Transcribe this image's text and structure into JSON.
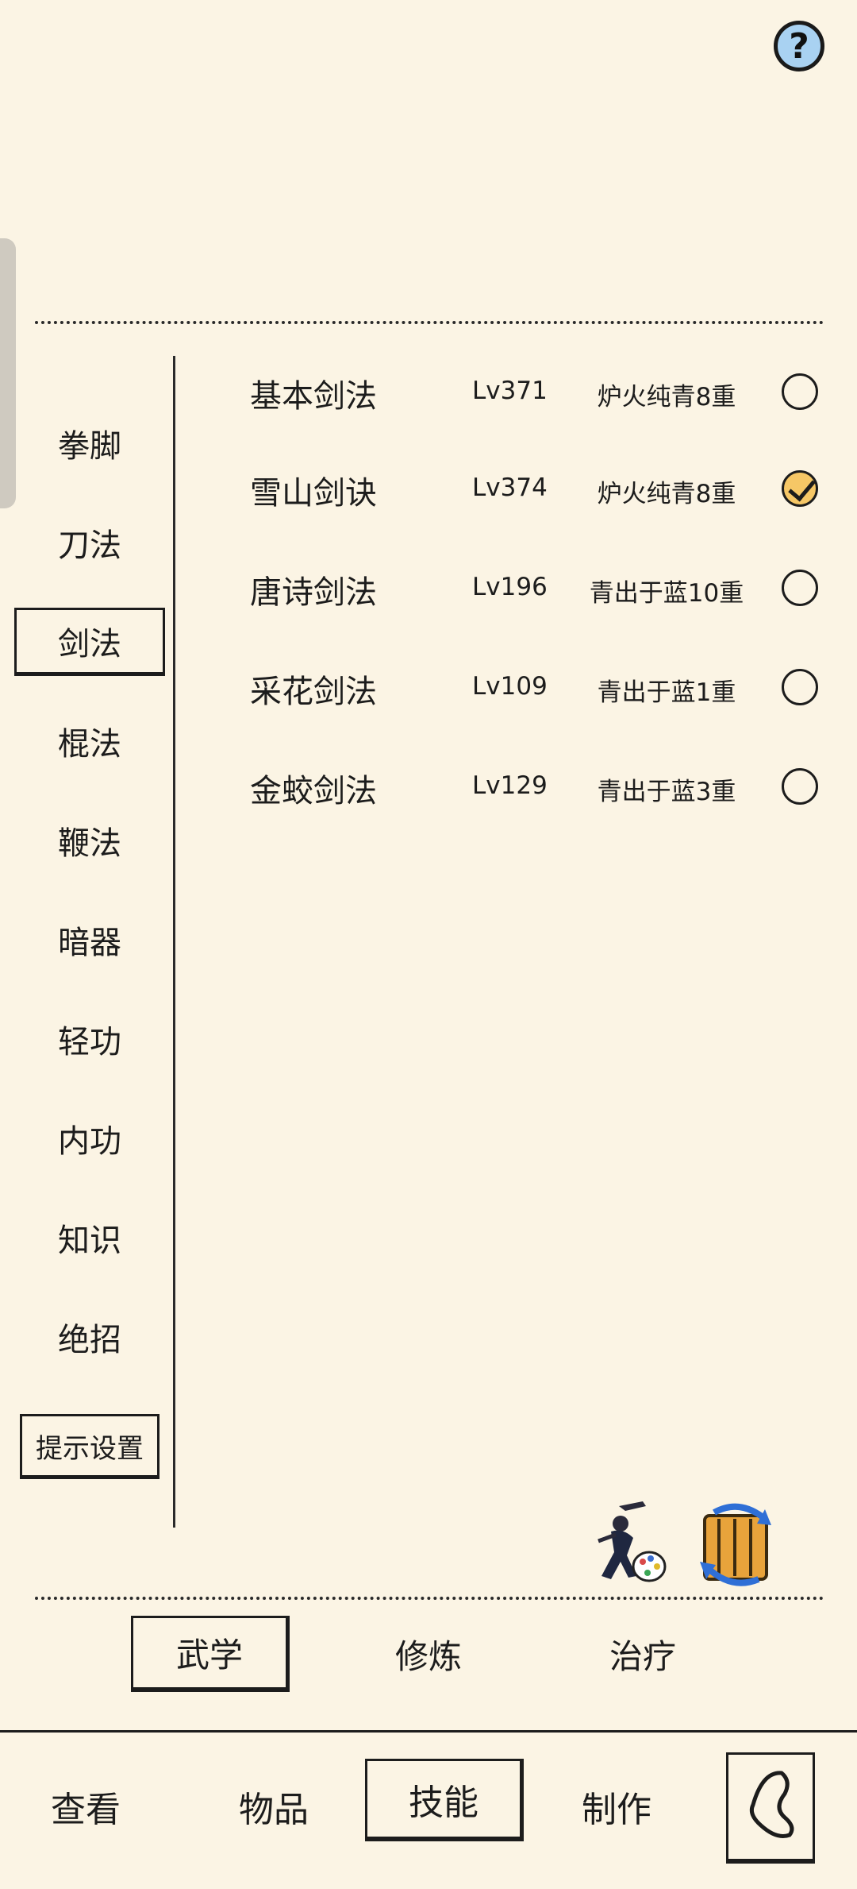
{
  "header": {
    "help_label": "?"
  },
  "categories": [
    {
      "label": "拳脚"
    },
    {
      "label": "刀法"
    },
    {
      "label": "剑法"
    },
    {
      "label": "棍法"
    },
    {
      "label": "鞭法"
    },
    {
      "label": "暗器"
    },
    {
      "label": "轻功"
    },
    {
      "label": "内功"
    },
    {
      "label": "知识"
    },
    {
      "label": "绝招"
    }
  ],
  "selected_category": "剑法",
  "hint_settings_label": "提示设置",
  "skills": [
    {
      "name": "基本剑法",
      "level": "Lv371",
      "rank": "炉火纯青8重",
      "checked": false
    },
    {
      "name": "雪山剑诀",
      "level": "Lv374",
      "rank": "炉火纯青8重",
      "checked": true
    },
    {
      "name": "唐诗剑法",
      "level": "Lv196",
      "rank": "青出于蓝10重",
      "checked": false
    },
    {
      "name": "采花剑法",
      "level": "Lv109",
      "rank": "青出于蓝1重",
      "checked": false
    },
    {
      "name": "金蛟剑法",
      "level": "Lv129",
      "rank": "青出于蓝3重",
      "checked": false
    }
  ],
  "sub_tabs": [
    {
      "label": "武学",
      "selected": true
    },
    {
      "label": "修炼",
      "selected": false
    },
    {
      "label": "治疗",
      "selected": false
    }
  ],
  "bottom_nav": [
    {
      "label": "查看",
      "selected": false
    },
    {
      "label": "物品",
      "selected": false
    },
    {
      "label": "技能",
      "selected": true
    },
    {
      "label": "制作",
      "selected": false
    }
  ],
  "icons": {
    "help": "question-mark-icon",
    "martial_paint": "swordsman-palette-icon",
    "refresh": "scroll-refresh-icon",
    "back": "back-arrow-icon"
  }
}
